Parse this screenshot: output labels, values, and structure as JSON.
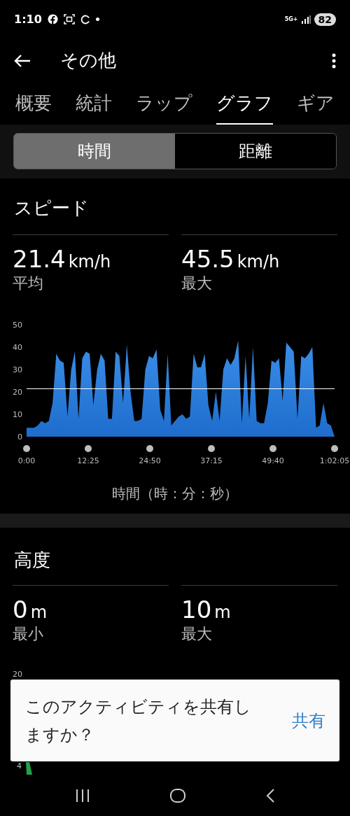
{
  "status_bar": {
    "time": "1:10",
    "network": "5G+",
    "battery": "82"
  },
  "app_bar": {
    "title": "その他"
  },
  "tabs": [
    {
      "label": "概要",
      "selected": false
    },
    {
      "label": "統計",
      "selected": false
    },
    {
      "label": "ラップ",
      "selected": false
    },
    {
      "label": "グラフ",
      "selected": true
    },
    {
      "label": "ギア",
      "selected": false
    }
  ],
  "segments": [
    {
      "label": "時間",
      "selected": true
    },
    {
      "label": "距離",
      "selected": false
    }
  ],
  "speed": {
    "title": "スピード",
    "stats": [
      {
        "value": "21.4",
        "unit": "km/h",
        "label": "平均"
      },
      {
        "value": "45.5",
        "unit": "km/h",
        "label": "最大"
      }
    ],
    "chart_data": {
      "type": "area",
      "xlabel": "時間（時：分：秒）",
      "ylim": [
        0,
        50
      ],
      "yticks": [
        0,
        10,
        20,
        30,
        40,
        50
      ],
      "xlim": [
        0,
        3725
      ],
      "x": [
        0,
        45,
        90,
        135,
        180,
        224,
        269,
        314,
        359,
        404,
        449,
        494,
        539,
        583,
        628,
        673,
        718,
        763,
        808,
        853,
        898,
        943,
        987,
        1032,
        1077,
        1122,
        1167,
        1212,
        1257,
        1302,
        1346,
        1391,
        1436,
        1481,
        1526,
        1571,
        1616,
        1661,
        1706,
        1750,
        1795,
        1840,
        1885,
        1930,
        1975,
        2020,
        2064,
        2109,
        2154,
        2199,
        2244,
        2289,
        2334,
        2379,
        2423,
        2468,
        2513,
        2558,
        2603,
        2648,
        2693,
        2738,
        2783,
        2827,
        2872,
        2917,
        2962,
        3007,
        3052,
        3097,
        3141,
        3186,
        3231,
        3276,
        3321,
        3366,
        3411,
        3456,
        3501,
        3545,
        3590,
        3635,
        3680,
        3725
      ],
      "xticks": [
        {
          "value": 0,
          "label": "0:00"
        },
        {
          "value": 745,
          "label": "12:25"
        },
        {
          "value": 1490,
          "label": "24:50"
        },
        {
          "value": 2235,
          "label": "37:15"
        },
        {
          "value": 2980,
          "label": "49:40"
        },
        {
          "value": 3725,
          "label": "1:02:05"
        }
      ],
      "series": [
        {
          "color": "#3a8fe8",
          "values": [
            4,
            4,
            4,
            5,
            7,
            6,
            7,
            15,
            37,
            34,
            33,
            9,
            30,
            38,
            8,
            35,
            38,
            37,
            14,
            30,
            37,
            34,
            8,
            8,
            38,
            36,
            15,
            41,
            20,
            7,
            7,
            8,
            30,
            36,
            35,
            39,
            12,
            7,
            37,
            5,
            7,
            9,
            10,
            8,
            9,
            37,
            31,
            31,
            37,
            14,
            7,
            20,
            7,
            30,
            35,
            32,
            35,
            43,
            6,
            36,
            8,
            40,
            7,
            6,
            6,
            15,
            34,
            33,
            35,
            16,
            42,
            40,
            38,
            8,
            36,
            35,
            37,
            40,
            4,
            5,
            15,
            6,
            5,
            0
          ]
        }
      ],
      "ref_lines": [
        {
          "axis": "y",
          "value": 21.4
        }
      ]
    }
  },
  "altitude": {
    "title": "高度",
    "stats": [
      {
        "value": "0",
        "unit": "m",
        "label": "最小"
      },
      {
        "value": "10",
        "unit": "m",
        "label": "最大"
      }
    ],
    "axis_labels": [
      "20",
      "4"
    ]
  },
  "share_prompt": {
    "message": "このアクティビティを共有しますか？",
    "action": "共有"
  }
}
